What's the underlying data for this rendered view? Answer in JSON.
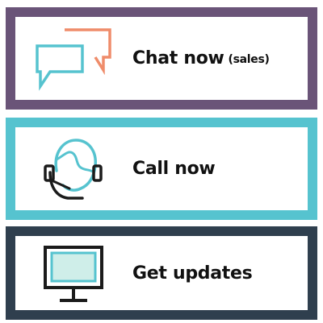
{
  "cards": [
    {
      "id": "chat",
      "label": "Chat now",
      "sublabel": "(sales)",
      "icon": "chat-bubbles-icon",
      "border_color": "#6a5478"
    },
    {
      "id": "call",
      "label": "Call now",
      "sublabel": "",
      "icon": "headset-agent-icon",
      "border_color": "#56c3cf"
    },
    {
      "id": "updates",
      "label": "Get updates",
      "sublabel": "",
      "icon": "monitor-icon",
      "border_color": "#2f3f4e"
    }
  ],
  "colors": {
    "accent_orange": "#ef8c6a",
    "accent_teal": "#56c3cf",
    "icon_dark": "#1b1b1b",
    "screen_fill": "#cfeee9"
  }
}
